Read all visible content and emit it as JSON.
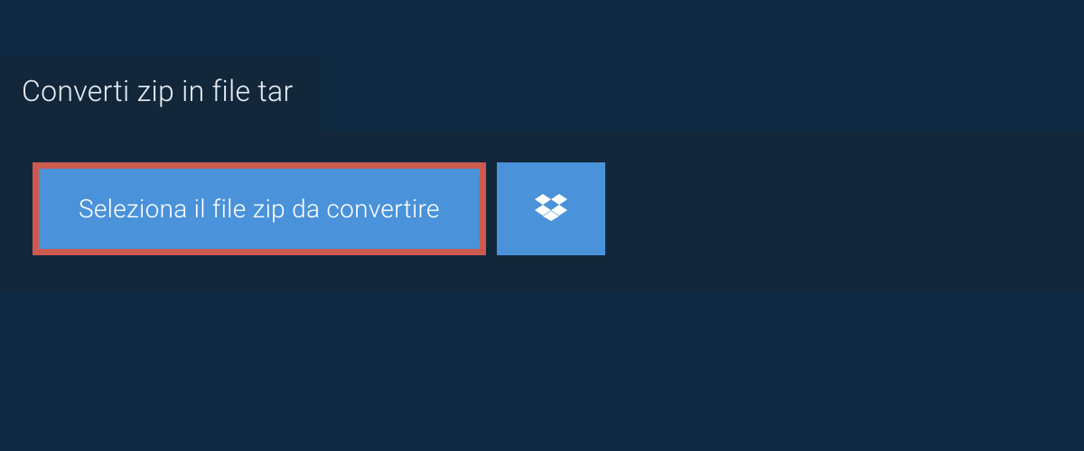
{
  "tab": {
    "title": "Converti zip in file tar"
  },
  "actions": {
    "select_file_label": "Seleziona il file zip da convertire"
  }
}
